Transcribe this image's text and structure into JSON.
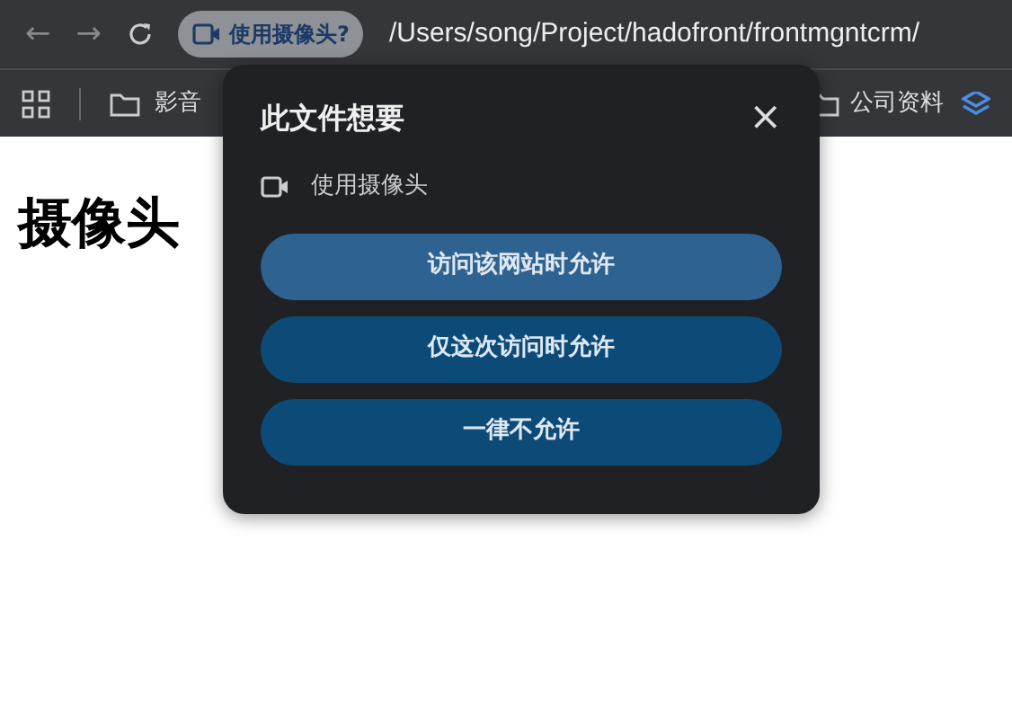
{
  "toolbar": {
    "back": "←",
    "forward": "→",
    "permission_chip": "使用摄像头?",
    "url": "/Users/song/Project/hadofront/frontmgntcrm/"
  },
  "bookmarks": [
    {
      "label": "影音"
    },
    {
      "label": "公司资料"
    }
  ],
  "page": {
    "heading": "摄像头"
  },
  "popup": {
    "title": "此文件想要",
    "close": "×",
    "permission": "使用摄像头",
    "buttons": [
      {
        "label": "访问该网站时允许",
        "focused": true
      },
      {
        "label": "仅这次访问时允许",
        "focused": false
      },
      {
        "label": "一律不允许",
        "focused": false
      }
    ]
  }
}
